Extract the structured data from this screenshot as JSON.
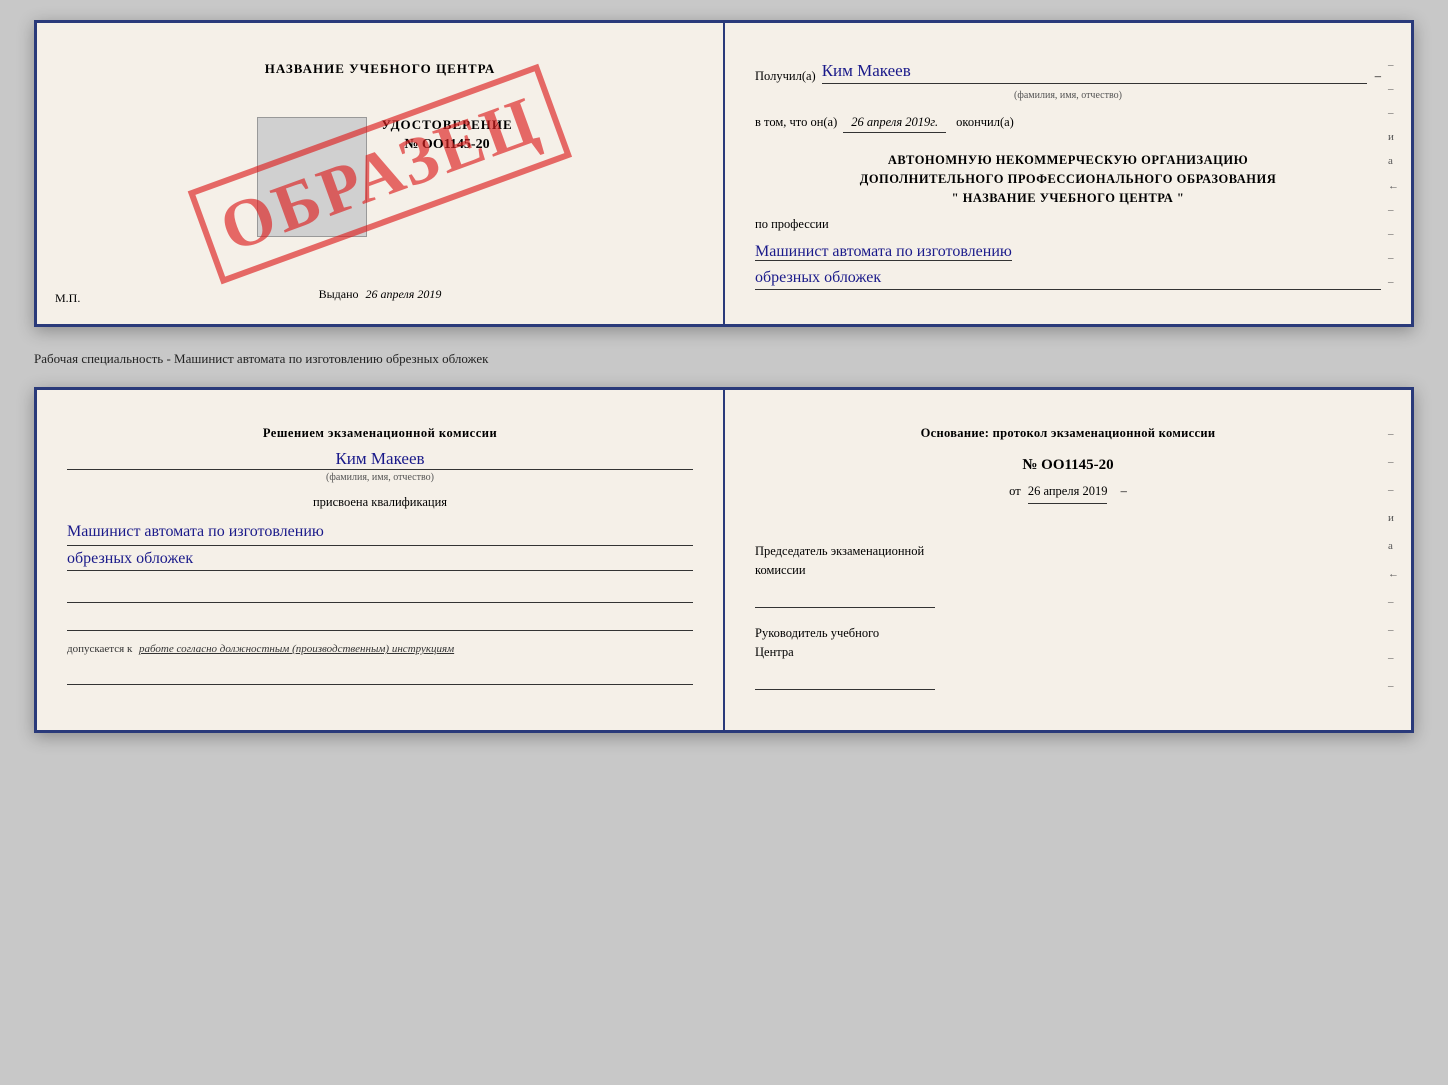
{
  "top_doc": {
    "left": {
      "school_name": "НАЗВАНИЕ УЧЕБНОГО ЦЕНТРА",
      "stamp_text": "ОБРАЗЕЦ",
      "udostoverenie_title": "УДОСТОВЕРЕНИЕ",
      "udostoverenie_number": "№ OO1145-20",
      "vydano_label": "Выдано",
      "vydano_date": "26 апреля 2019",
      "mp_label": "М.П."
    },
    "right": {
      "recipient_label": "Получил(а)",
      "recipient_name": "Ким Макеев",
      "fio_subtitle": "(фамилия, имя, отчество)",
      "date_label": "в том, что он(а)",
      "date_value": "26 апреля 2019г.",
      "okончил_label": "окончил(а)",
      "org_line1": "АВТОНОМНУЮ НЕКОММЕРЧЕСКУЮ ОРГАНИЗАЦИЮ",
      "org_line2": "ДОПОЛНИТЕЛЬНОГО ПРОФЕССИОНАЛЬНОГО ОБРАЗОВАНИЯ",
      "org_line3": "\"  НАЗВАНИЕ УЧЕБНОГО ЦЕНТРА  \"",
      "profession_label": "по профессии",
      "profession_line1": "Машинист автомата по изготовлению",
      "profession_line2": "обрезных обложек",
      "margin_chars": [
        "–",
        "–",
        "–",
        "и",
        "а",
        "←",
        "–",
        "–",
        "–",
        "–"
      ]
    }
  },
  "separator": {
    "text": "Рабочая специальность - Машинист автомата по изготовлению обрезных обложек"
  },
  "bottom_doc": {
    "left": {
      "exam_commission_label": "Решением экзаменационной комиссии",
      "person_name": "Ким Макеев",
      "fio_subtitle": "(фамилия, имя, отчество)",
      "assigned_label": "присвоена квалификация",
      "qualification_line1": "Машинист автомата по изготовлению",
      "qualification_line2": "обрезных обложек",
      "допускается_text": "допускается к",
      "допускается_italic": "работе согласно должностным (производственным) инструкциям"
    },
    "right": {
      "osnov_label": "Основание: протокол экзаменационной комиссии",
      "protocol_number": "№  OO1145-20",
      "protocol_date_prefix": "от",
      "protocol_date": "26 апреля 2019",
      "chairman_label_line1": "Председатель экзаменационной",
      "chairman_label_line2": "комиссии",
      "rukovoditel_line1": "Руководитель учебного",
      "rukovoditel_line2": "Центра",
      "margin_chars": [
        "–",
        "–",
        "–",
        "и",
        "а",
        "←",
        "–",
        "–",
        "–",
        "–"
      ]
    }
  }
}
